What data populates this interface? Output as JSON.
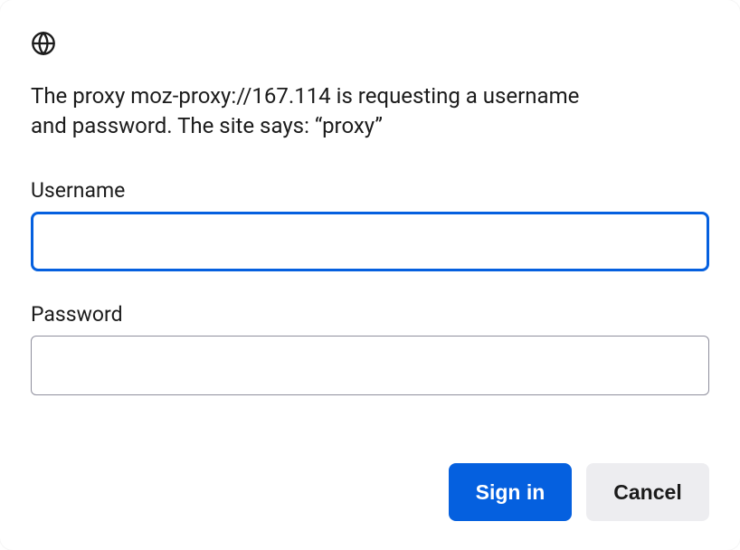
{
  "message": "The proxy moz-proxy://167.114 is requesting a username and password. The site says: “proxy”",
  "fields": {
    "username": {
      "label": "Username",
      "value": ""
    },
    "password": {
      "label": "Password",
      "value": ""
    }
  },
  "buttons": {
    "signin": "Sign in",
    "cancel": "Cancel"
  },
  "icons": {
    "globe": "globe-icon"
  }
}
